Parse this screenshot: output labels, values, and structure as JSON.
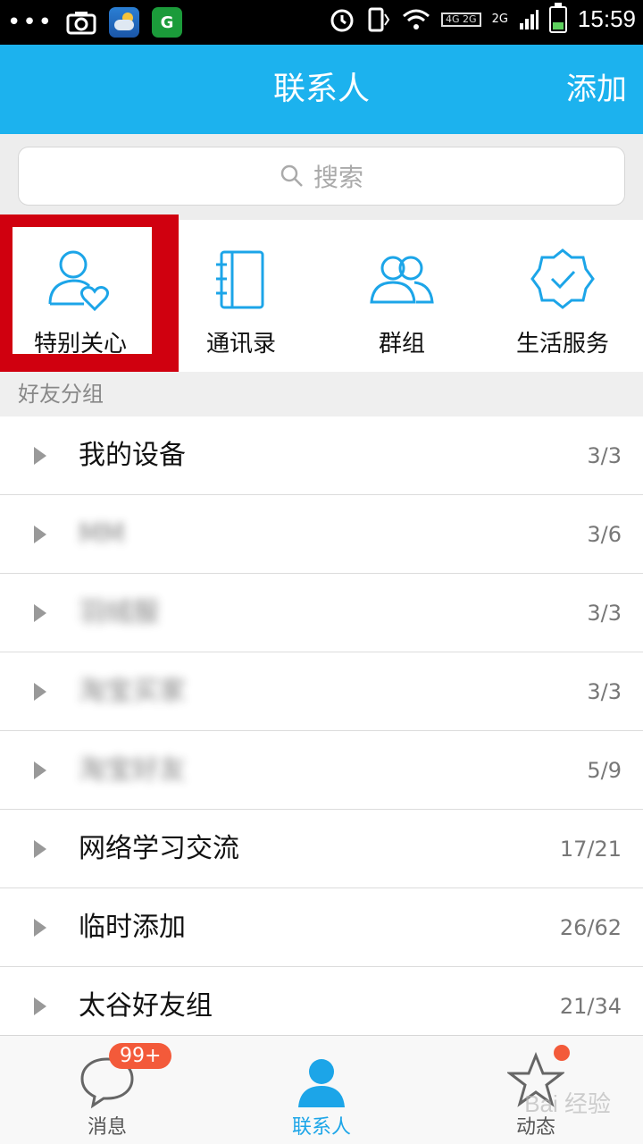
{
  "status_bar": {
    "time": "15:59",
    "network": "4G 2G",
    "signal_label": "2G"
  },
  "header": {
    "title": "联系人",
    "add_label": "添加"
  },
  "search": {
    "placeholder": "搜索"
  },
  "shortcuts": [
    {
      "label": "特别关心",
      "icon": "user-heart-icon"
    },
    {
      "label": "通讯录",
      "icon": "address-book-icon"
    },
    {
      "label": "群组",
      "icon": "group-icon"
    },
    {
      "label": "生活服务",
      "icon": "verified-badge-icon"
    }
  ],
  "section_title": "好友分组",
  "groups": [
    {
      "name": "我的设备",
      "count": "3/3"
    },
    {
      "name": "MM",
      "count": "3/6"
    },
    {
      "name": "羽绒服",
      "count": "3/3"
    },
    {
      "name": "淘宝买家",
      "count": "3/3"
    },
    {
      "name": "淘宝好友",
      "count": "5/9"
    },
    {
      "name": "网络学习交流",
      "count": "17/21"
    },
    {
      "name": "临时添加",
      "count": "26/62"
    },
    {
      "name": "太谷好友组",
      "count": "21/34"
    }
  ],
  "tabs": [
    {
      "label": "消息",
      "badge": "99+"
    },
    {
      "label": "联系人"
    },
    {
      "label": "动态"
    }
  ],
  "colors": {
    "accent": "#1cb2ee",
    "highlight": "#d0000f",
    "badge": "#f35a3a"
  },
  "watermark": "Bai 经验"
}
